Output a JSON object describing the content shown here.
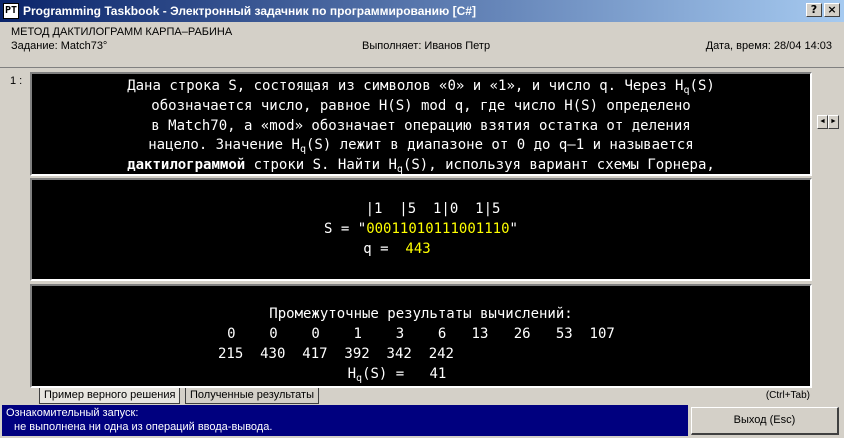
{
  "window": {
    "title": "Programming Taskbook - Электронный задачник по программированию [C#]",
    "icon_label": "PT",
    "help_label": "?",
    "close_label": "×"
  },
  "info": {
    "topic": "МЕТОД ДАКТИЛОГРАММ КАРПА–РАБИНА",
    "task": "Задание: Match73°",
    "student": "Выполняет: Иванов Петр",
    "datetime": "Дата, время: 28/04 14:03"
  },
  "pane_number": "1 :",
  "task_text": {
    "l1a": "Дана строка S, состоящая из символов «0» и «1», и число q. Через H",
    "l1sub": "q",
    "l1b": "(S)",
    "l2": "обозначается число, равное H(S) mod q, где число H(S) определено",
    "l3": "в Match70, а «mod» обозначает операцию взятия остатка от деления",
    "l4a": "нацело. Значение H",
    "l4sub": "q",
    "l4b": "(S) лежит в диапазоне от 0 до q–1 и называется",
    "l5bold": "дактилограммой",
    "l5a": " строки S. Найти H",
    "l5sub": "q",
    "l5b": "(S), используя вариант схемы Горнера,"
  },
  "input_data": {
    "ruler": "|1  |5  1|0  1|5",
    "s_label": "S = \"",
    "s_value": "00011010111001110",
    "s_end": "\"",
    "q_label": "q =  ",
    "q_value": "443"
  },
  "results": {
    "heading": "Промежуточные результаты вычислений:",
    "row1": "0    0    0    1    3    6   13   26   53  107",
    "row2": "215  430  417  392  342  242",
    "final_a": "H",
    "final_sub": "q",
    "final_b": "(S) =   41"
  },
  "scroll": {
    "left": "◄",
    "right": "►"
  },
  "tabs": [
    {
      "label": "Пример верного решения"
    },
    {
      "label": "Полученные результаты"
    }
  ],
  "shortcut": "(Ctrl+Tab)",
  "status": {
    "line1": "Ознакомительный запуск:",
    "line2": "не выполнена ни одна из операций ввода-вывода."
  },
  "exit_label": "Выход (Esc)"
}
